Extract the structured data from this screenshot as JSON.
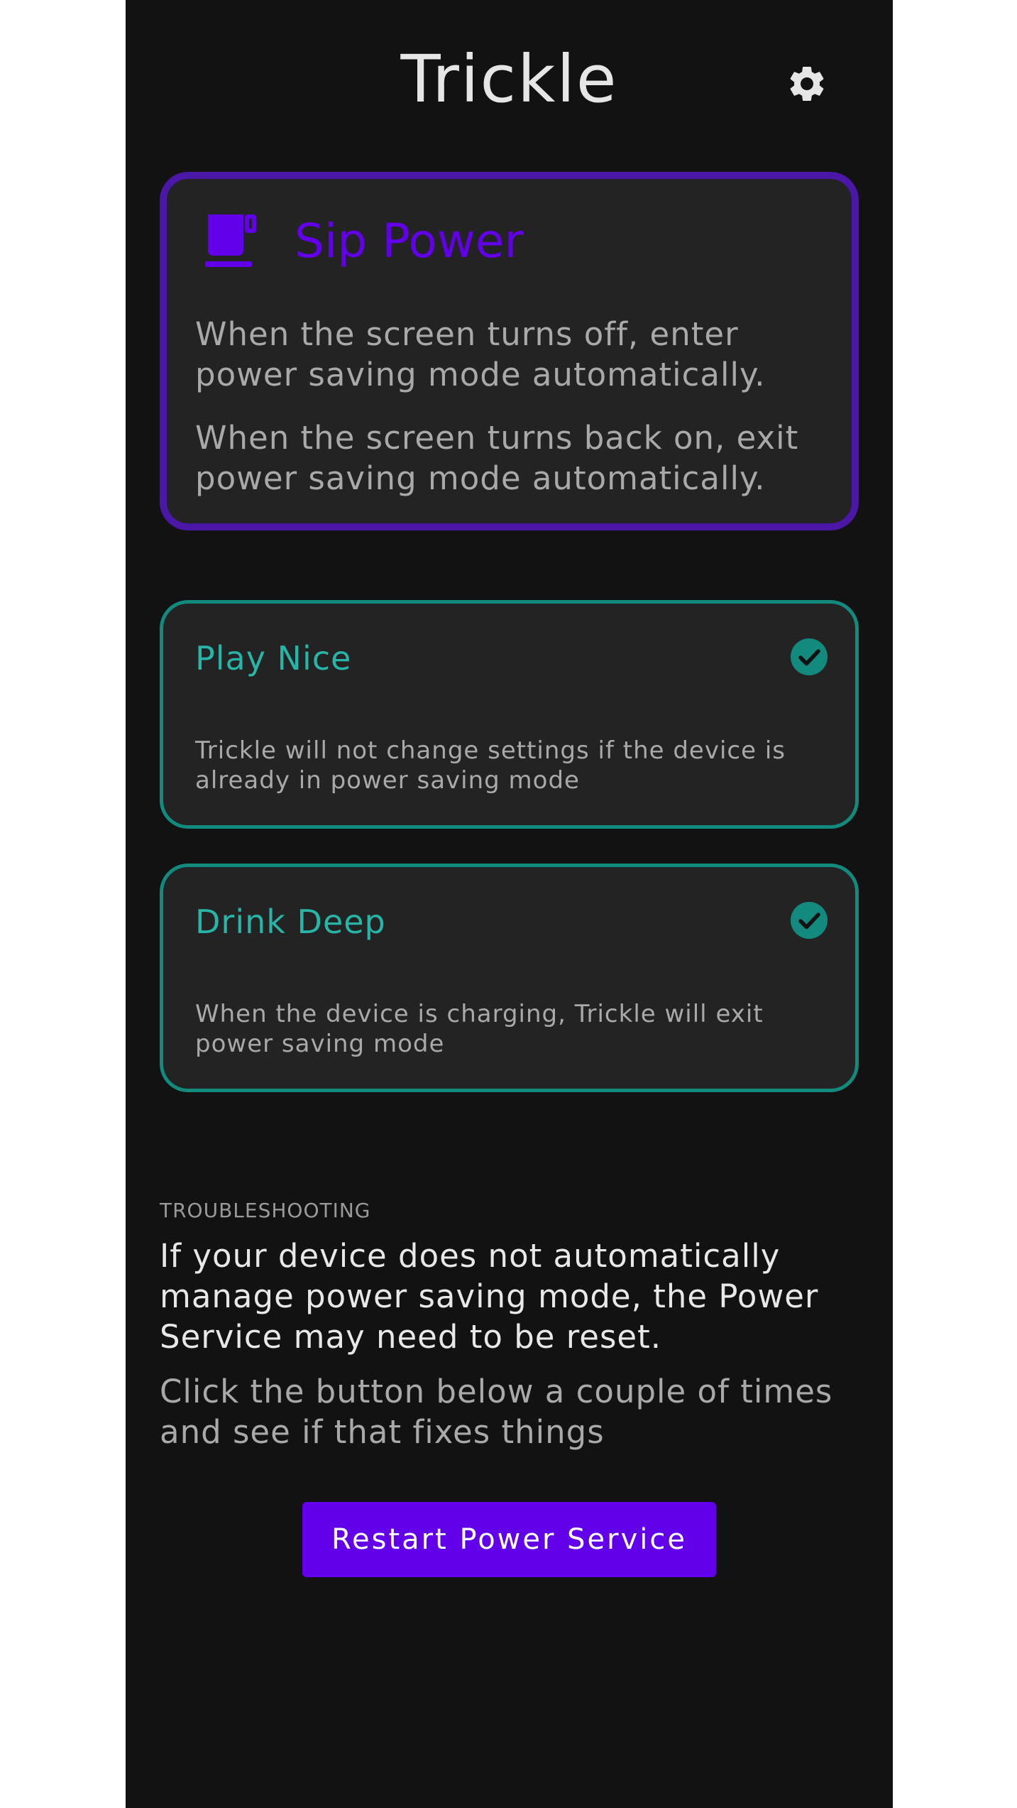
{
  "header": {
    "title": "Trickle",
    "settings_icon": "gear-icon"
  },
  "sip_power": {
    "icon": "coffee-cup-icon",
    "title": "Sip Power",
    "paragraph1": "When the screen turns off, enter power saving mode automatically.",
    "paragraph2": "When the screen turns back on, exit power saving mode automatically.",
    "accent_color": "#6200ea",
    "border_color": "#4a17a6"
  },
  "options": [
    {
      "title": "Play Nice",
      "description": "Trickle will not change settings if the device is already in power saving mode",
      "checked": true,
      "icon": "check-circle-icon"
    },
    {
      "title": "Drink Deep",
      "description": "When the device is charging, Trickle will exit power saving mode",
      "checked": true,
      "icon": "check-circle-icon"
    }
  ],
  "troubleshooting": {
    "label": "TROUBLESHOOTING",
    "main_text": "If your device does not automatically manage power saving mode, the Power Service may need to be reset.",
    "sub_text": "Click the button below a couple of times and see if that fixes things",
    "button_label": "Restart Power Service"
  },
  "colors": {
    "background": "#121212",
    "card": "#232323",
    "teal": "#138a7e",
    "teal_text": "#26b5a6",
    "button": "#6200ea"
  }
}
